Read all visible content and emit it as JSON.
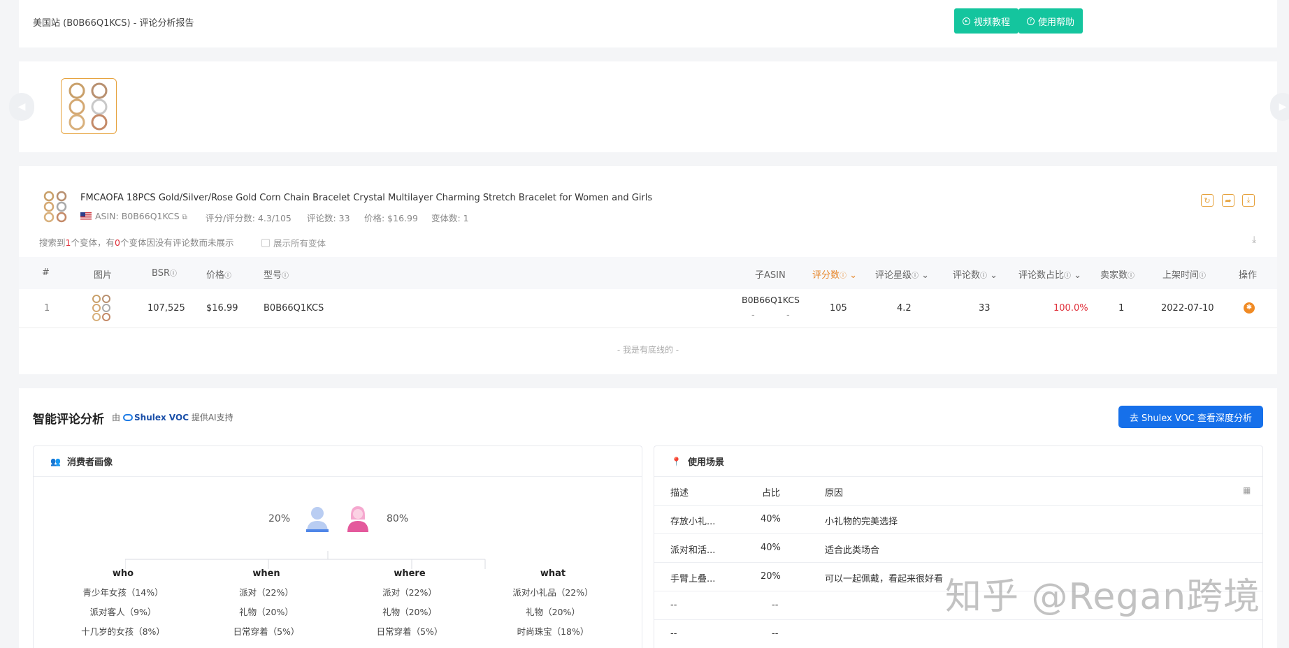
{
  "header": {
    "title": "美国站 (B0B66Q1KCS) - 评论分析报告",
    "video_btn": "视频教程",
    "help_btn": "使用帮助"
  },
  "product": {
    "name": "FMCAOFA 18PCS Gold/Silver/Rose Gold Corn Chain Bracelet Crystal Multilayer Charming Stretch Bracelet for Women and Girls",
    "asin": "ASIN: B0B66Q1KCS",
    "rating": "评分/评分数: 4.3/105",
    "reviews": "评论数: 33",
    "price": "价格: $16.99",
    "variants": "变体数: 1",
    "found_prefix": "搜索到",
    "found_count": "1",
    "found_mid": "个变体，有",
    "found_missing": "0",
    "found_suffix": "个变体因没有评论数而未展示",
    "show_all": "展示所有变体"
  },
  "table": {
    "headers": {
      "idx": "#",
      "img": "图片",
      "bsr": "BSR",
      "price": "价格",
      "model": "型号",
      "child_asin": "子ASIN",
      "ratings": "评分数",
      "stars": "评论星级",
      "reviews": "评论数",
      "ratio": "评论数占比",
      "sellers": "卖家数",
      "listed": "上架时间",
      "ops": "操作"
    },
    "row": {
      "idx": "1",
      "bsr": "107,525",
      "price": "$16.99",
      "model": "B0B66Q1KCS",
      "child_asin": "B0B66Q1KCS",
      "dash1": "-",
      "dash2": "-",
      "ratings": "105",
      "stars": "4.2",
      "reviews": "33",
      "ratio": "100.0%",
      "sellers": "1",
      "listed": "2022-07-10"
    },
    "footer": "- 我是有底线的 -"
  },
  "ai": {
    "title": "智能评论分析",
    "by_prefix": "由",
    "brand": "Shulex VOC",
    "by_suffix": "提供AI支持",
    "cta": "去 Shulex VOC 查看深度分析",
    "consumer": {
      "title": "消费者画像",
      "male_pct": "20%",
      "female_pct": "80%",
      "columns": [
        {
          "head": "who",
          "items": [
            "青少年女孩（14%）",
            "派对客人（9%）",
            "十几岁的女孩（8%）"
          ]
        },
        {
          "head": "when",
          "items": [
            "派对（22%）",
            "礼物（20%）",
            "日常穿着（5%）"
          ]
        },
        {
          "head": "where",
          "items": [
            "派对（22%）",
            "礼物（20%）",
            "日常穿着（5%）"
          ]
        },
        {
          "head": "what",
          "items": [
            "派对小礼品（22%）",
            "礼物（20%）",
            "时尚珠宝（18%）"
          ]
        }
      ]
    },
    "scene": {
      "title": "使用场景",
      "headers": {
        "desc": "描述",
        "ratio": "占比",
        "reason": "原因"
      },
      "rows": [
        {
          "desc": "存放小礼...",
          "ratio": "40%",
          "reason": "小礼物的完美选择"
        },
        {
          "desc": "派对和活...",
          "ratio": "40%",
          "reason": "适合此类场合"
        },
        {
          "desc": "手臂上叠...",
          "ratio": "20%",
          "reason": "可以一起佩戴，看起来很好看"
        },
        {
          "desc": "--",
          "ratio": "--",
          "reason": ""
        },
        {
          "desc": "--",
          "ratio": "--",
          "reason": ""
        }
      ]
    }
  },
  "watermark": "知乎 @Regan跨境",
  "colors": {
    "accent": "#14c59e",
    "orange": "#e6862a",
    "blue": "#1670ea",
    "red": "#e0303a"
  }
}
